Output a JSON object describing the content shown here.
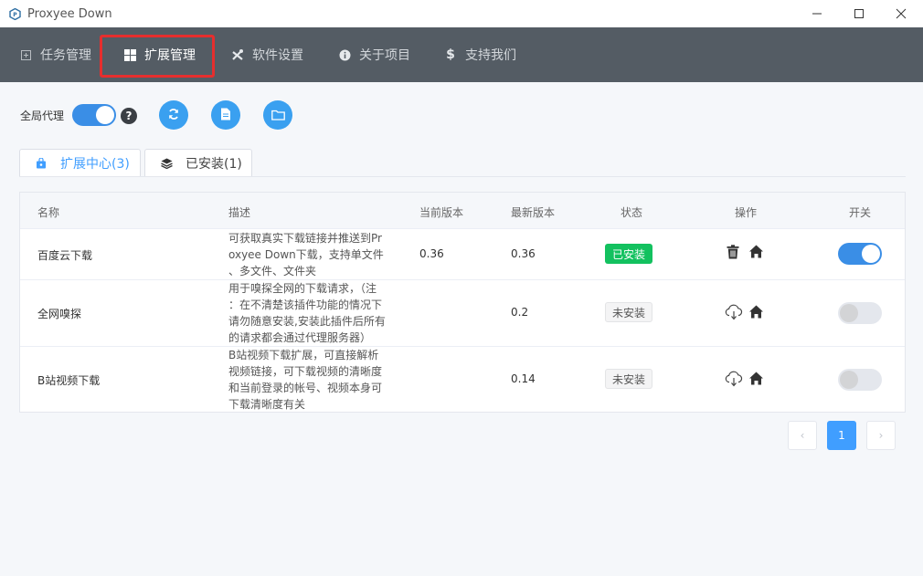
{
  "window": {
    "title": "Proxyee Down",
    "controls": {
      "minimize": "minimize-icon",
      "maximize": "maximize-icon",
      "close": "close-icon"
    }
  },
  "nav": {
    "items": [
      {
        "label": "任务管理",
        "icon": "task-icon"
      },
      {
        "label": "扩展管理",
        "icon": "windows-icon",
        "active": true
      },
      {
        "label": "软件设置",
        "icon": "tools-icon"
      },
      {
        "label": "关于项目",
        "icon": "info-icon"
      },
      {
        "label": "支持我们",
        "icon": "dollar-icon"
      }
    ],
    "background": "#545c64",
    "highlight_color": "#e62e2e"
  },
  "toolbar": {
    "proxy_label": "全局代理",
    "proxy_enabled": true,
    "help": "?",
    "buttons": [
      "refresh-icon",
      "file-icon",
      "folder-icon"
    ]
  },
  "tabs": [
    {
      "label": "扩展中心(3)",
      "icon": "store-icon",
      "active": true
    },
    {
      "label": "已安装(1)",
      "icon": "layers-icon"
    }
  ],
  "table": {
    "headers": [
      "名称",
      "描述",
      "当前版本",
      "最新版本",
      "状态",
      "操作",
      "开关"
    ],
    "rows": [
      {
        "name": "百度云下载",
        "description": "可获取真实下载链接并推送到Pr\noxyee Down下载，支持单文件\n、多文件、文件夹",
        "current_version": "0.36",
        "latest_version": "0.36",
        "status": "已安装",
        "installed": true,
        "enabled": true
      },
      {
        "name": "全网嗅探",
        "description": "用于嗅探全网的下载请求，（注\n：在不清楚该插件功能的情况下\n请勿随意安装,安装此插件后所有\n的请求都会通过代理服务器）",
        "current_version": "",
        "latest_version": "0.2",
        "status": "未安装",
        "installed": false,
        "enabled": false
      },
      {
        "name": "B站视频下载",
        "description": "B站视频下载扩展，可直接解析\n视频链接，可下载视频的清晰度\n和当前登录的帐号、视频本身可\n下载清晰度有关",
        "current_version": "",
        "latest_version": "0.14",
        "status": "未安装",
        "installed": false,
        "enabled": false
      }
    ]
  },
  "pagination": {
    "prev": "‹",
    "current": "1",
    "next": "›"
  },
  "colors": {
    "accent": "#409eff",
    "installed": "#13c15f"
  }
}
